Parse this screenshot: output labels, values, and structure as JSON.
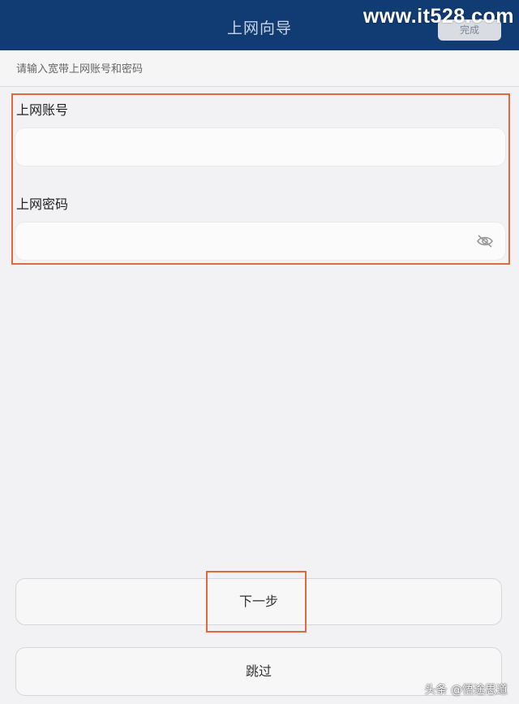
{
  "header": {
    "title": "上网向导",
    "right_button_label": "完成",
    "watermark": "www.it528.com"
  },
  "instruction": "请输入宽带上网账号和密码",
  "form": {
    "account_label": "上网账号",
    "account_value": "",
    "password_label": "上网密码",
    "password_value": ""
  },
  "buttons": {
    "next": "下一步",
    "skip": "跳过"
  },
  "credit": "头条 @悟途思道",
  "icons": {
    "password_toggle": "eye-closed-icon"
  },
  "colors": {
    "header_bg": "#103b73",
    "highlight": "#e06a3b",
    "page_bg": "#f2f2f4"
  }
}
